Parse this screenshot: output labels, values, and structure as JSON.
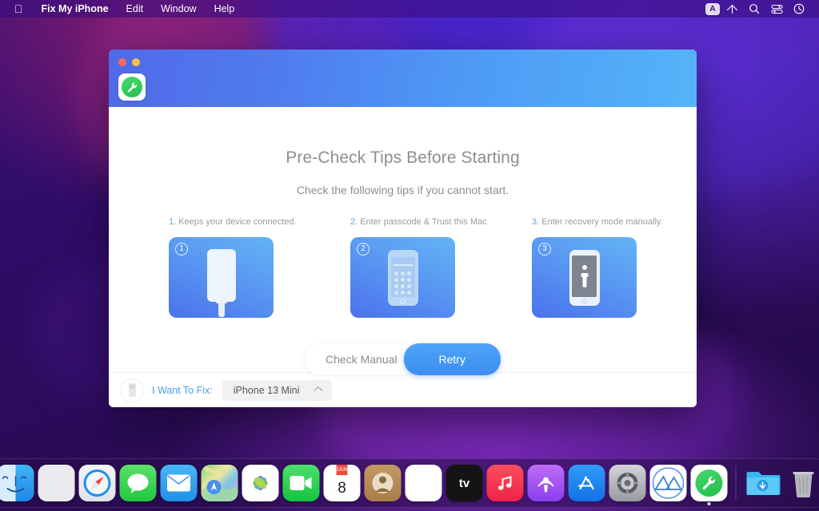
{
  "menubar": {
    "apple_icon": "apple-logo-icon",
    "items": [
      {
        "label": "Fix My iPhone",
        "bold": true
      },
      {
        "label": "Edit",
        "bold": false
      },
      {
        "label": "Window",
        "bold": false
      },
      {
        "label": "Help",
        "bold": false
      }
    ],
    "status_items": [
      {
        "name": "input-source-badge",
        "label": "A"
      },
      {
        "name": "wifi-icon",
        "label": ""
      },
      {
        "name": "search-icon",
        "label": ""
      },
      {
        "name": "control-center-icon",
        "label": ""
      },
      {
        "name": "siri-icon",
        "label": ""
      }
    ]
  },
  "window": {
    "traffic_lights": [
      "close",
      "minimize"
    ],
    "app_icon": "wrench-icon",
    "accent_color": "#3d8ef2",
    "title": "Pre-Check Tips Before Starting",
    "subtitle": "Check the following tips if you cannot start.",
    "tips": [
      {
        "number": "1.",
        "text": "Keeps your device connected.",
        "badge": "1",
        "art": "phone-with-cable"
      },
      {
        "number": "2.",
        "text": "Enter passcode & Trust this Mac",
        "badge": "2",
        "art": "phone-passcode"
      },
      {
        "number": "3.",
        "text": "Enter recovery mode manually.",
        "badge": "3",
        "art": "phone-recovery"
      }
    ],
    "buttons": {
      "secondary": "Check Manual",
      "primary": "Retry"
    },
    "footer": {
      "device_icon": "device-connector-icon",
      "label": "I Want To Fix:",
      "selected_device": "iPhone 13 Mini",
      "chevron": "chevron-up-icon"
    }
  },
  "dock": {
    "items": [
      {
        "name": "finder",
        "label": "Finder"
      },
      {
        "name": "launchpad",
        "label": "Launchpad"
      },
      {
        "name": "safari",
        "label": "Safari"
      },
      {
        "name": "messages",
        "label": "Messages"
      },
      {
        "name": "mail",
        "label": "Mail"
      },
      {
        "name": "maps",
        "label": "Maps"
      },
      {
        "name": "photos",
        "label": "Photos"
      },
      {
        "name": "facetime",
        "label": "FaceTime"
      },
      {
        "name": "calendar",
        "label": "Calendar",
        "month": "JAN",
        "day": "8"
      },
      {
        "name": "contacts",
        "label": "Contacts"
      },
      {
        "name": "notes",
        "label": "Notes"
      },
      {
        "name": "apple-tv",
        "label": "tv"
      },
      {
        "name": "music",
        "label": "Music"
      },
      {
        "name": "podcasts",
        "label": "Podcasts"
      },
      {
        "name": "app-store",
        "label": "App Store"
      },
      {
        "name": "system-settings",
        "label": "System Settings"
      },
      {
        "name": "app-cleaner",
        "label": "App Cleaner"
      },
      {
        "name": "fix-my-iphone",
        "label": "Fix My iPhone",
        "running": true
      }
    ],
    "trailing": [
      {
        "name": "downloads-folder",
        "label": "Downloads"
      },
      {
        "name": "trash",
        "label": "Trash"
      }
    ]
  }
}
